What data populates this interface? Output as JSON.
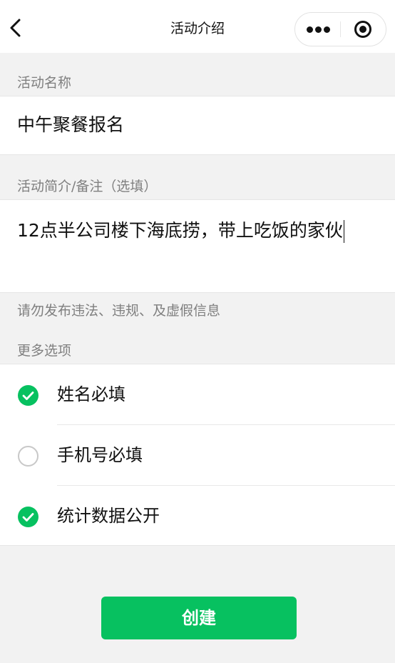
{
  "navbar": {
    "title": "活动介绍"
  },
  "activity_name": {
    "label": "活动名称",
    "value": "中午聚餐报名"
  },
  "activity_intro": {
    "label": "活动简介/备注（选填）",
    "value": "12点半公司楼下海底捞，带上吃饭的家伙"
  },
  "notice": "请勿发布违法、违规、及虚假信息",
  "more_options": {
    "label": "更多选项",
    "items": [
      {
        "label": "姓名必填",
        "checked": true
      },
      {
        "label": "手机号必填",
        "checked": false
      },
      {
        "label": "统计数据公开",
        "checked": true
      }
    ]
  },
  "submit": {
    "label": "创建"
  },
  "colors": {
    "accent": "#07c160",
    "background": "#f2f2f2"
  }
}
